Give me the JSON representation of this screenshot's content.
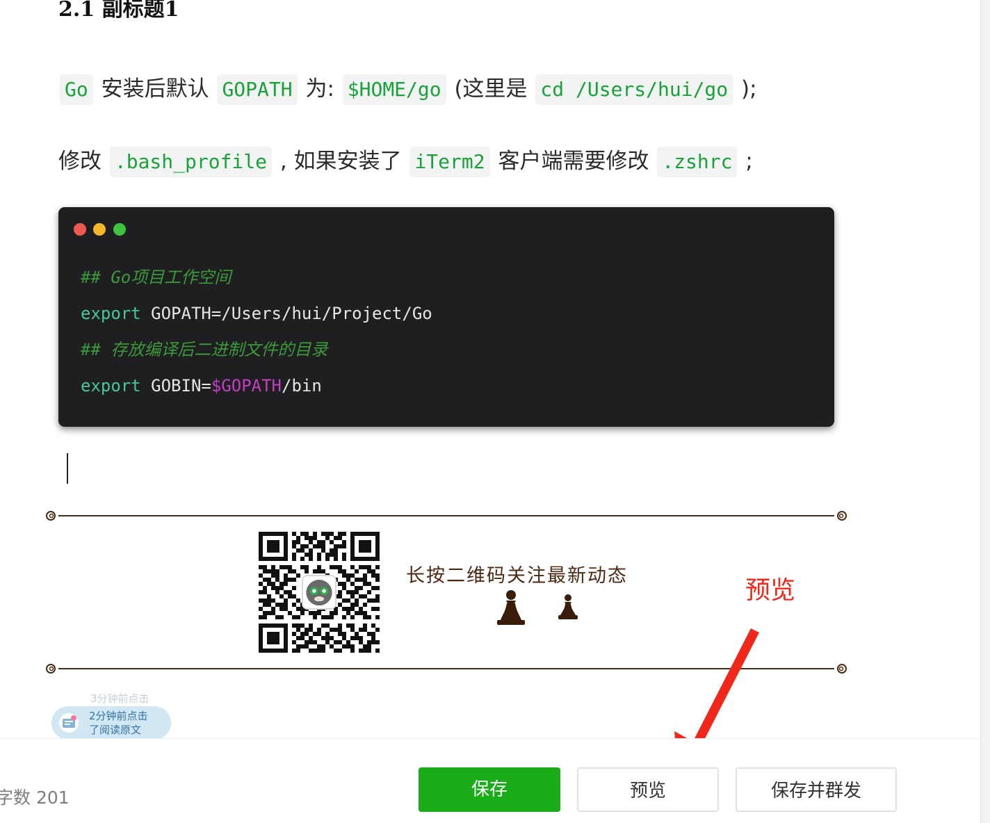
{
  "article": {
    "subheading": "2.1 副标题1",
    "para1": {
      "t0": "Go",
      "t1": " 安装后默认 ",
      "t2": "GOPATH",
      "t3": " 为: ",
      "t4": "$HOME/go",
      "t5": " (这里是 ",
      "t6": "cd /Users/hui/go",
      "t7": " );"
    },
    "para2": {
      "t0": "修改 ",
      "t1": ".bash_profile",
      "t2": " , 如果安装了 ",
      "t3": "iTerm2",
      "t4": " 客户端需要修改 ",
      "t5": ".zshrc",
      "t6": " ;"
    },
    "code": {
      "comment1": "## Go项目工作空间",
      "l2_kw": "export",
      "l2_rest": " GOPATH=/Users/hui/Project/Go",
      "comment2": "## 存放编译后二进制文件的目录",
      "l4_kw": "export",
      "l4_pre": " GOBIN=",
      "l4_var": "$GOPATH",
      "l4_post": "/bin"
    }
  },
  "qr_section": {
    "follow_text": "长按二维码关注最新动态"
  },
  "annotation": {
    "label": "预览",
    "color": "#f0281a"
  },
  "read_badge": {
    "ghost_text": "3分钟前点击",
    "line1": "2分钟前点击",
    "line2": "了阅读原文"
  },
  "footer": {
    "word_count": "字数  201",
    "save_label": "保存",
    "preview_label": "预览",
    "publish_label": "保存并群发"
  },
  "colors": {
    "save_green": "#1aad19",
    "inline_code_green": "#19a23a",
    "code_bg": "#1f1f21",
    "follow_brown": "#4e2a13"
  }
}
